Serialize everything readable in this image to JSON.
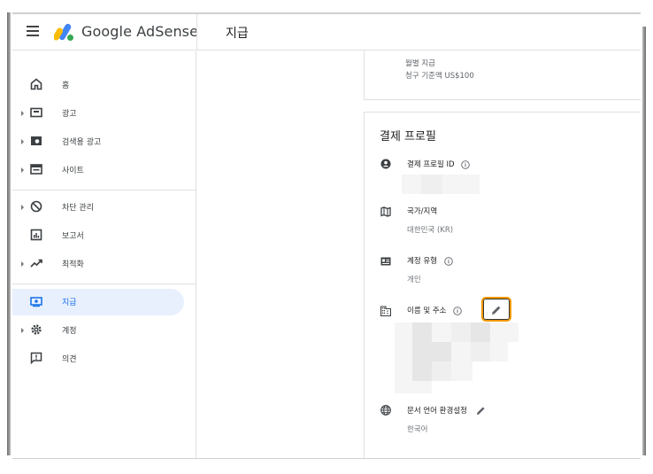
{
  "header": {
    "brand_google": "Google",
    "brand_product": "AdSense",
    "page_title": "지급"
  },
  "sidebar": {
    "items": [
      {
        "label": "홈",
        "icon": "home-icon"
      },
      {
        "label": "광고",
        "icon": "ad-icon"
      },
      {
        "label": "검색용 광고",
        "icon": "search-ad-icon"
      },
      {
        "label": "사이트",
        "icon": "site-icon"
      },
      {
        "label": "차단 관리",
        "icon": "block-icon"
      },
      {
        "label": "보고서",
        "icon": "report-icon"
      },
      {
        "label": "최적화",
        "icon": "trending-icon"
      },
      {
        "label": "지급",
        "icon": "payment-icon"
      },
      {
        "label": "계정",
        "icon": "gear-icon"
      },
      {
        "label": "의견",
        "icon": "feedback-icon"
      }
    ]
  },
  "payment_schedule": {
    "line1": "월별 지급",
    "line2": "청구 기준액 US$100"
  },
  "profile": {
    "title": "결제 프로필",
    "profile_id_label": "결제 프로필 ID",
    "country_label": "국가/지역",
    "country_value": "대한민국 (KR)",
    "account_type_label": "계정 유형",
    "account_type_value": "개인",
    "name_address_label": "이름 및 주소",
    "doc_lang_label": "문서 언어 환경설정",
    "doc_lang_value": "한국어"
  },
  "colors": {
    "active_bg": "#e8f0fe",
    "active_text": "#1a73e8",
    "highlight_border": "#f29900"
  }
}
